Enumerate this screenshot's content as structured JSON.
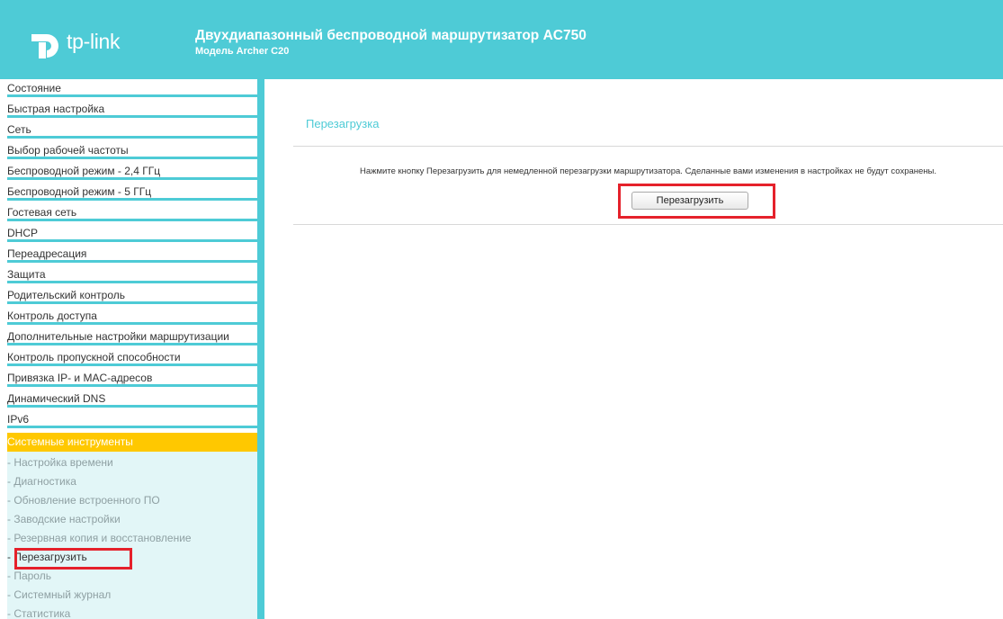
{
  "header": {
    "logo_text": "tp-link",
    "title": "Двухдиапазонный беспроводной маршрутизатор AC750",
    "model": "Модель Archer C20",
    "bg_color": "#4ecbd6"
  },
  "sidebar": {
    "items": [
      {
        "label": "Состояние"
      },
      {
        "label": "Быстрая настройка"
      },
      {
        "label": "Сеть"
      },
      {
        "label": "Выбор рабочей частоты"
      },
      {
        "label": "Беспроводной режим - 2,4 ГГц"
      },
      {
        "label": "Беспроводной режим - 5 ГГц"
      },
      {
        "label": "Гостевая сеть"
      },
      {
        "label": "DHCP"
      },
      {
        "label": "Переадресация"
      },
      {
        "label": "Защита"
      },
      {
        "label": "Родительский контроль"
      },
      {
        "label": "Контроль доступа"
      },
      {
        "label": "Дополнительные настройки маршрутизации"
      },
      {
        "label": "Контроль пропускной способности"
      },
      {
        "label": "Привязка IP- и MAC-адресов"
      },
      {
        "label": "Динамический DNS"
      },
      {
        "label": "IPv6"
      },
      {
        "label": "Системные инструменты"
      }
    ],
    "active_item": "Системные инструменты",
    "sub_items": [
      {
        "label": "- Настройка времени"
      },
      {
        "label": "- Диагностика"
      },
      {
        "label": "- Обновление встроенного ПО"
      },
      {
        "label": "- Заводские настройки"
      },
      {
        "label": "- Резервная копия и восстановление"
      },
      {
        "label": "- Перезагрузить"
      },
      {
        "label": "- Пароль"
      },
      {
        "label": "- Системный журнал"
      },
      {
        "label": "- Статистика"
      }
    ],
    "current_sub_item": "- Перезагрузить",
    "active_color": "#ffc800",
    "submenu_bg": "#e2f6f7"
  },
  "main": {
    "heading": "Перезагрузка",
    "notice": "Нажмите кнопку Перезагрузить для немедленной перезагрузки маршрутизатора. Сделанные вами изменения в настройках не будут сохранены.",
    "reboot_button_label": "Перезагрузить"
  },
  "annotations": {
    "highlight_color": "#e5212b"
  }
}
